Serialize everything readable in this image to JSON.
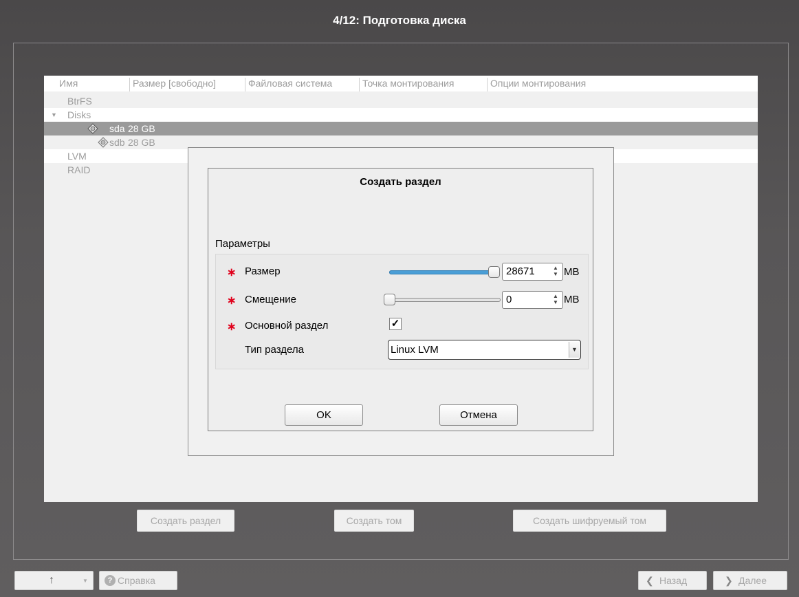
{
  "window": {
    "title": "4/12: Подготовка диска"
  },
  "tree": {
    "columns": [
      "Имя",
      "Размер [свободно]",
      "Файловая система",
      "Точка монтирования",
      "Опции монтирования"
    ],
    "rows": {
      "btrfs": "BtrFS",
      "disks": "Disks",
      "sda_name": "sda",
      "sda_size": "28 GB",
      "sdb_name": "sdb",
      "sdb_size": "28 GB",
      "lvm": "LVM",
      "raid": "RAID"
    },
    "expand_icon": "triangle-down-icon",
    "disk_icon": "harddisk-icon"
  },
  "actions": {
    "create_partition": "Создать раздел",
    "create_volume": "Создать том",
    "create_encrypted_volume": "Создать шифруемый том"
  },
  "dialog": {
    "title": "Создать раздел",
    "group_label": "Параметры",
    "size_label": "Размер",
    "size_value": "28671",
    "size_fraction": 1.0,
    "size_unit": "MB",
    "offset_label": "Смещение",
    "offset_value": "0",
    "offset_fraction": 0.0,
    "offset_unit": "MB",
    "primary_label": "Основной раздел",
    "primary_checked": true,
    "check_mark": "✓",
    "type_label": "Тип раздела",
    "type_value": "Linux LVM",
    "required_marker": "∗",
    "ok_label": "OK",
    "cancel_label": "Отмена",
    "accent_color": "#4a9ed6",
    "required_color": "#e0001b"
  },
  "footer": {
    "up_icon": "arrow-up-icon",
    "help_label": "Справка",
    "back_label": "Назад",
    "next_label": "Далее"
  }
}
